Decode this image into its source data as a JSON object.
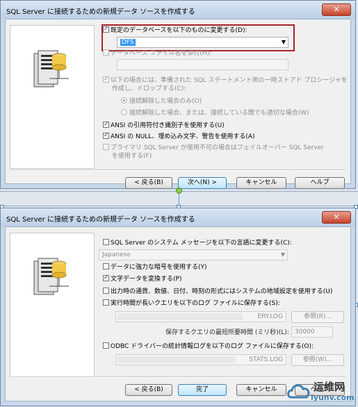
{
  "dialog1": {
    "title": "SQL Server に接続するための新規データ ソースを作成する",
    "change_default_db_label": "既定のデータベースを以下のものに変更する(D):",
    "default_db_value": "DFS",
    "attach_db_file_label": "データベース ファイル名を添付(H):",
    "temp_procs_label": "以下の場合には、準備された SQL ステートメント用の一時ストアド プロシージャを",
    "temp_procs_label2": "作成し、ドロップする(C):",
    "radio_disconnect_only": "接続解除した場合のみ(O)",
    "radio_disconnect_or_connected": "接続解除した場合、または、接続している間でも適切な場合(W)",
    "ansi_quoted_label": "ANSI の引用符付き識別子を使用する(U)",
    "ansi_nulls_label": "ANSI の NULL、埋め込み文字、警告を使用する(A)",
    "failover_label": "プライマリ SQL Server が使用不可の場合はフェイルオーバー SQL Server",
    "failover_label2": "を使用する(F)",
    "back_button": "< 戻る(B)",
    "next_button": "次へ(N) >",
    "cancel_button": "キャンセル",
    "help_button": "ヘルプ"
  },
  "dialog2": {
    "title": "SQL Server に接続するための新規データ ソースを作成する",
    "change_language_label": "SQL Server のシステム メッセージを以下の言語に変更する(C):",
    "language_value": "Japanese",
    "strong_encryption_label": "データに強力な暗号を使用する(Y)",
    "translate_char_label": "文字データを変換する(P)",
    "regional_settings_label": "出力時の通貨、数値、日付、時刻の形式にはシステムの地域設定を使用する(U)",
    "long_query_label": "実行時間が長いクエリを以下のログ ファイルに保存する(S):",
    "long_query_file_suffix": "ERY.LOG",
    "browse1_button": "参照(R)...",
    "long_query_time_label": "保存するクエリの最短所要時間 (ミリ秒)(L):",
    "long_query_time_value": "30000",
    "odbc_stats_label": "ODBC ドライバーの統計情報ログを以下のログ ファイルに保存する(O):",
    "stats_file_suffix": "STATS.LOG",
    "browse2_button": "参照(W)...",
    "back_button": "< 戻る(B)",
    "finish_button": "完了",
    "cancel_button": "キャンセル",
    "help_button": "ヘルプ"
  },
  "watermark": {
    "text": "运维网",
    "url": "iyunv.com"
  },
  "colors": {
    "highlight_border": "#a8242b",
    "selection": "#3399ff",
    "title_gradient_top": "#d9e6f4"
  }
}
